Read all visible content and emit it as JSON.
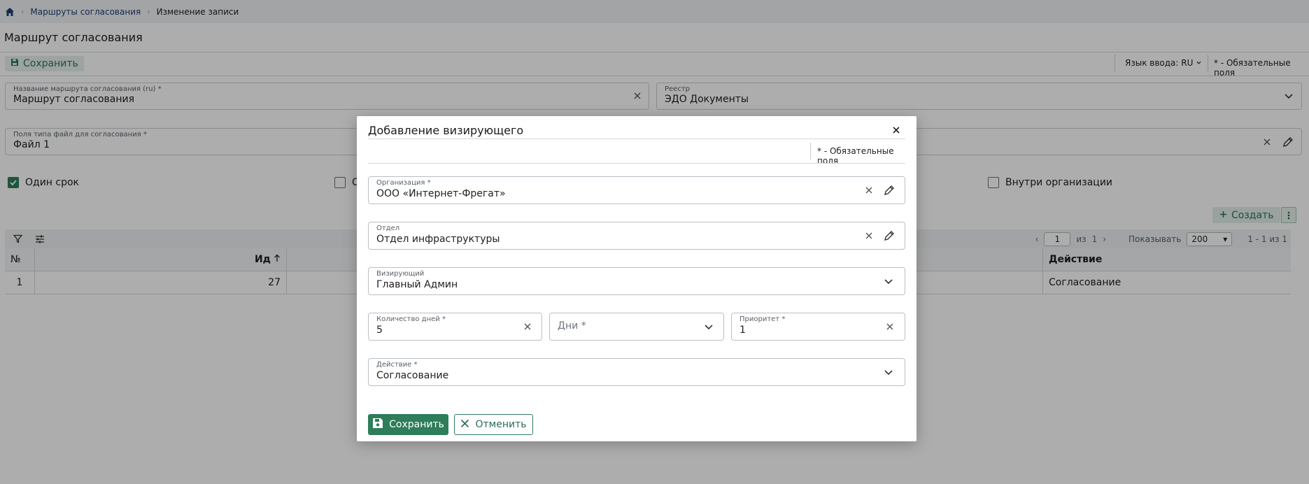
{
  "breadcrumb": {
    "link": "Маршруты согласования",
    "current": "Изменение записи"
  },
  "page_title": "Маршрут согласования",
  "toolbar": {
    "save_label": "Сохранить",
    "lang_label": "Язык ввода: RU",
    "required_note": "* - Обязательные поля"
  },
  "form": {
    "route_name": {
      "label": "Название маршрута согласования (ru) *",
      "value": "Маршрут согласования"
    },
    "registry": {
      "label": "Реестр",
      "value": "ЭДО Документы"
    },
    "file_fields": {
      "label": "Поля типа файл для согласования *",
      "value": "Файл 1"
    },
    "checkboxes": [
      {
        "label": "Один срок",
        "checked": true
      },
      {
        "label": "С",
        "checked": false
      },
      {
        "label": "Внутри организации",
        "checked": false
      }
    ]
  },
  "grid": {
    "create_label": "Создать",
    "pager": {
      "page": "1",
      "of_label": "из",
      "total_pages": "1",
      "show_label": "Показывать",
      "page_size": "200",
      "range": "1 - 1 из 1"
    },
    "columns": {
      "num": "№",
      "id": "Ид",
      "action": "Действие"
    },
    "rows": [
      {
        "num": "1",
        "id": "27",
        "action": "Согласование"
      }
    ]
  },
  "modal": {
    "title": "Добавление визирующего",
    "required_note": "* - Обязательные поля",
    "organization": {
      "label": "Организация *",
      "value": "ООО «Интернет-Фрегат»"
    },
    "department": {
      "label": "Отдел",
      "value": "Отдел инфраструктуры"
    },
    "approver": {
      "label": "Визирующий",
      "value": "Главный Админ"
    },
    "days_count": {
      "label": "Количество дней *",
      "value": "5"
    },
    "days_type": {
      "placeholder": "Дни *"
    },
    "priority": {
      "label": "Приоритет *",
      "value": "1"
    },
    "action": {
      "label": "Действие *",
      "value": "Согласование"
    },
    "save_label": "Сохранить",
    "cancel_label": "Отменить"
  },
  "colors": {
    "accent": "#2e7d5b",
    "accent_light": "#e2efe9",
    "link": "#1d3f73"
  }
}
